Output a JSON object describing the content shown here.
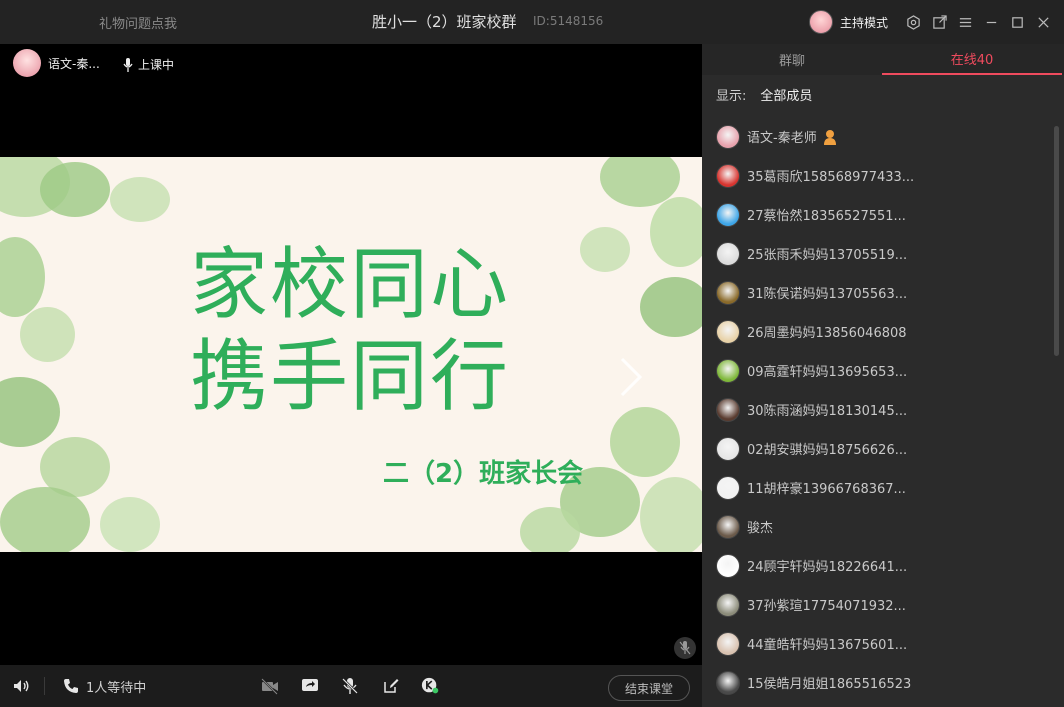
{
  "titlebar": {
    "left_text": "礼物问题点我",
    "title": "胜小一（2）班家校群",
    "group_id": "ID:5148156",
    "mode_label": "主持模式",
    "icons": [
      "settings-icon",
      "popout-icon",
      "menu-icon",
      "minimize-icon",
      "maximize-icon",
      "close-icon"
    ]
  },
  "video": {
    "teacher_name": "语文-秦...",
    "status": "上课中",
    "slide": {
      "line1": "家校同心",
      "line2": "携手同行",
      "subtitle": "二（2）班家长会"
    }
  },
  "bottombar": {
    "waiting": "1人等待中",
    "end_class": "结束课堂",
    "icons": [
      "speaker-icon",
      "phone-icon",
      "camera-off-icon",
      "screen-share-icon",
      "mic-off-icon",
      "edit-icon",
      "k-app-icon"
    ]
  },
  "panel": {
    "tabs": [
      "群聊",
      "在线40"
    ],
    "active_tab": 1,
    "filter_label": "显示:",
    "filter_value": "全部成员",
    "members": [
      {
        "name": "语文-秦老师",
        "color": "#e8a2ad",
        "host": true
      },
      {
        "name": "35葛雨欣158568977433...",
        "color": "#d8342f"
      },
      {
        "name": "27蔡怡然18356527551...",
        "color": "#3ea6e8"
      },
      {
        "name": "25张雨禾妈妈13705519...",
        "color": "#dcdcdc"
      },
      {
        "name": "31陈俣诺妈妈13705563...",
        "color": "#8a6a2a"
      },
      {
        "name": "26周墨妈妈13856046808",
        "color": "#e8d2a8"
      },
      {
        "name": "09高霆轩妈妈13695653...",
        "color": "#7fb83a"
      },
      {
        "name": "30陈雨涵妈妈18130145...",
        "color": "#5a3c30"
      },
      {
        "name": "02胡安骐妈妈18756626...",
        "color": "#e6e6e6"
      },
      {
        "name": "11胡梓豪13966768367...",
        "color": "#f2f2f2"
      },
      {
        "name": "骏杰",
        "color": "#6b5a4a"
      },
      {
        "name": "24顾宇轩妈妈18226641...",
        "color": "#ffffff"
      },
      {
        "name": "37孙紫瑄17754071932...",
        "color": "#8c8c7a"
      },
      {
        "name": "44童皓轩妈妈13675601...",
        "color": "#d9c2b0"
      },
      {
        "name": "15侯皓月姐姐1865516523",
        "color": "#4a4a4a"
      }
    ]
  },
  "colors": {
    "accent": "#ef4b5e",
    "slide_green": "#2fae5a"
  }
}
